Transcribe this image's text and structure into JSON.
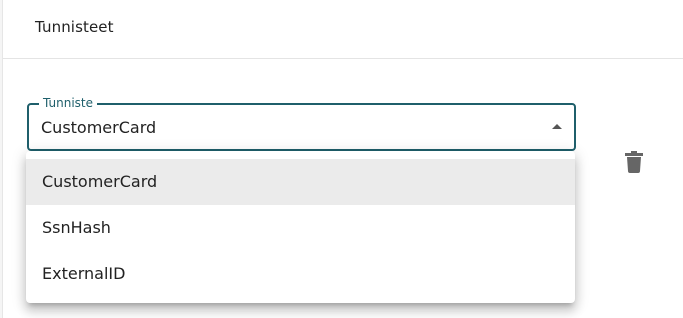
{
  "card": {
    "title": "Tunnisteet"
  },
  "field": {
    "legend": "Tunniste",
    "value": "CustomerCard",
    "caret_icon": "arrow-drop-up-icon"
  },
  "delete": {
    "icon": "trash-icon"
  },
  "menu": {
    "items": [
      {
        "label": "CustomerCard",
        "selected": true
      },
      {
        "label": "SsnHash",
        "selected": false
      },
      {
        "label": "ExternalID",
        "selected": false
      }
    ]
  },
  "colors": {
    "accent": "#1f5f6b",
    "selected_bg": "#ebebeb"
  }
}
